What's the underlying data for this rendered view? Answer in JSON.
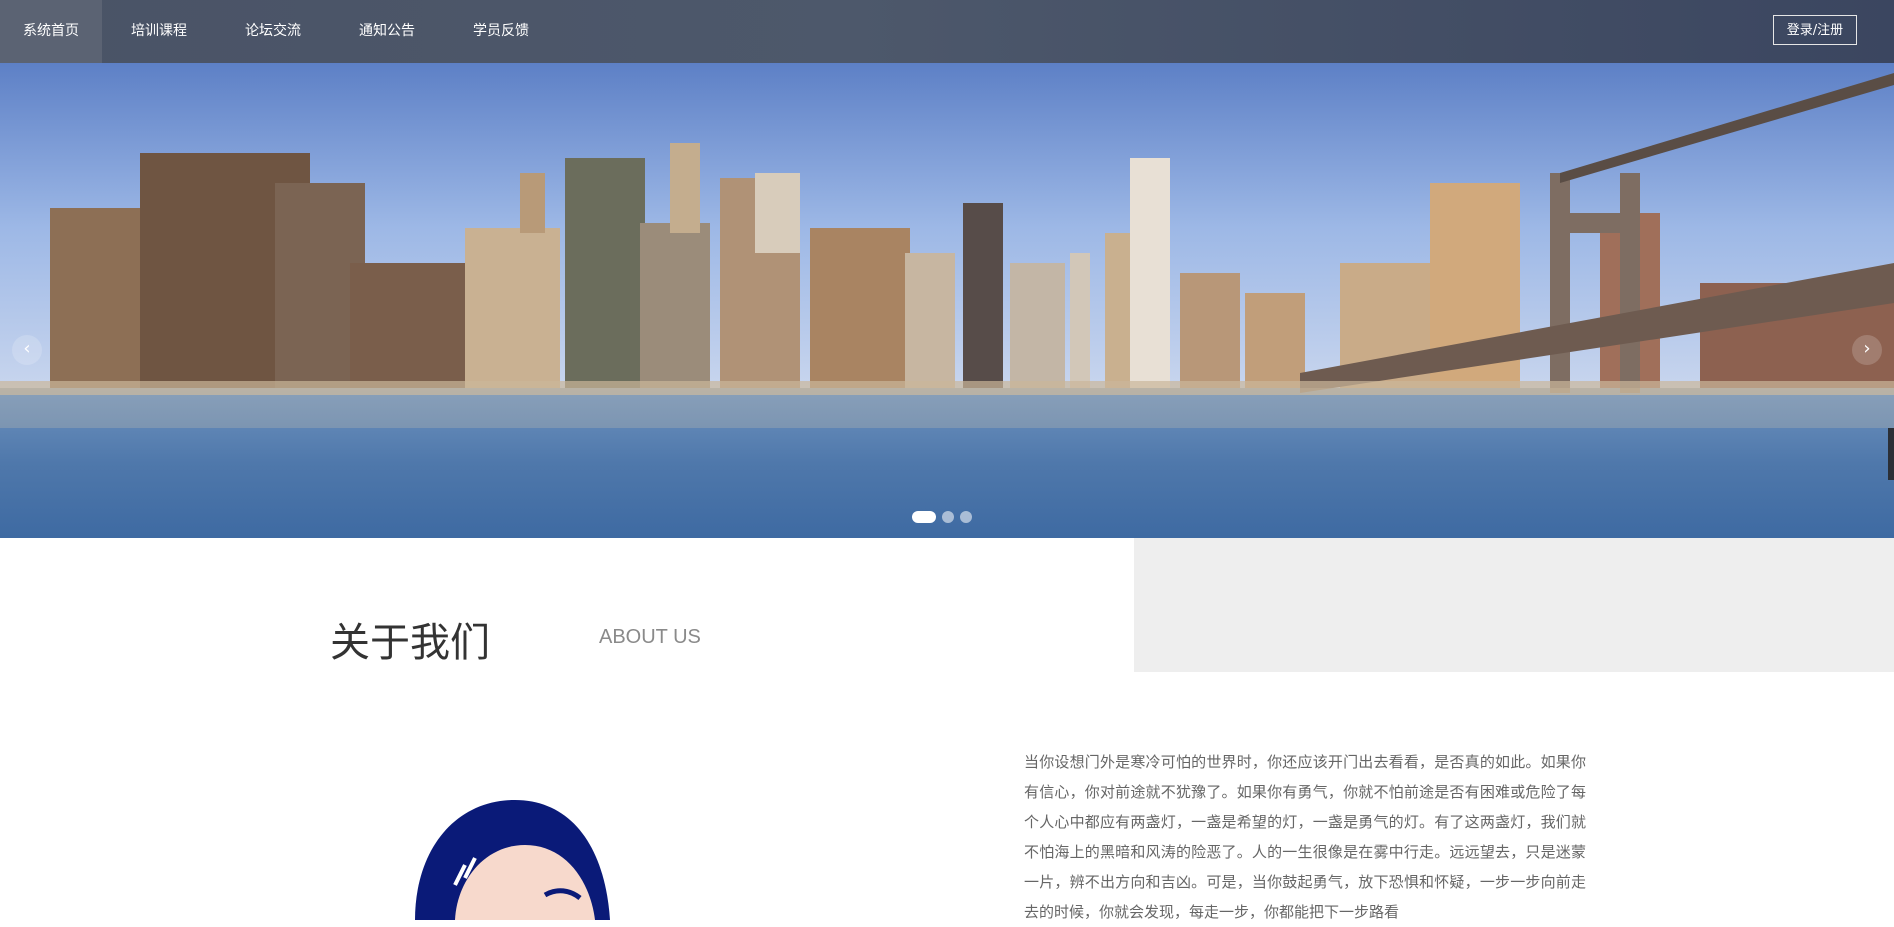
{
  "nav": {
    "items": [
      {
        "label": "系统首页",
        "active": true
      },
      {
        "label": "培训课程",
        "active": false
      },
      {
        "label": "论坛交流",
        "active": false
      },
      {
        "label": "通知公告",
        "active": false
      },
      {
        "label": "学员反馈",
        "active": false
      }
    ],
    "login_label": "登录/注册"
  },
  "banner": {
    "prev_icon": "‹",
    "next_icon": "›",
    "slides": 3,
    "active_slide": 1
  },
  "about": {
    "title": "关于我们",
    "subtitle": "ABOUT US",
    "text": "当你设想门外是寒冷可怕的世界时，你还应该开门出去看看，是否真的如此。如果你有信心，你对前途就不犹豫了。如果你有勇气，你就不怕前途是否有困难或危险了每个人心中都应有两盏灯，一盏是希望的灯，一盏是勇气的灯。有了这两盏灯，我们就不怕海上的黑暗和风涛的险恶了。人的一生很像是在雾中行走。远远望去，只是迷蒙一片，辨不出方向和吉凶。可是，当你鼓起勇气，放下恐惧和怀疑，一步一步向前走去的时候，你就会发现，每走一步，你都能把下一步路看"
  },
  "colors": {
    "nav_bg": "#4d586b",
    "active_nav": "#5b6373",
    "gray_block": "#eeeeee"
  }
}
